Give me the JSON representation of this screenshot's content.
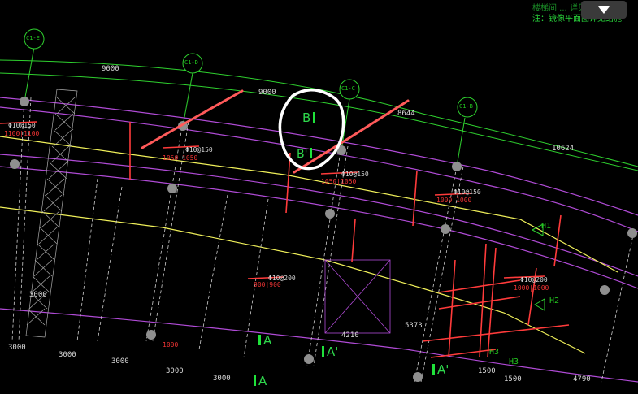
{
  "header": {
    "line1": "楼梯间 ... 详见 ...",
    "line2": "注：镜像平面图详见结施",
    "dropdown_icon": "chevron-down-icon"
  },
  "colors": {
    "background": "#000000",
    "axis_line": "#2fd12f",
    "beam_purple": "#b04bd6",
    "beam_yellow": "#f0f05a",
    "beam_red": "#ff3b3b",
    "annotation_stroke": "#ff5a5a",
    "highlight_circle": "#ffffff",
    "dim_text": "#d9d9d9"
  },
  "axes": {
    "bubbles": [
      "C1-E",
      "C1-D",
      "C1-C",
      "C1-B"
    ]
  },
  "dimensions": {
    "top": [
      "9000",
      "9000",
      "8644",
      "10624"
    ],
    "bottom": [
      "3000",
      "3000",
      "3000",
      "3000",
      "3000",
      "3000"
    ],
    "misc": [
      "4210",
      "5373",
      "1500",
      "1500",
      "4790",
      "3000"
    ]
  },
  "sections": [
    "B",
    "B'",
    "A",
    "A'",
    "A'",
    "A",
    "H1",
    "H2",
    "H3",
    "H3"
  ],
  "beam_labels": {
    "reinforce": [
      "Φ10@150",
      "Φ10@150",
      "Φ10@150",
      "Φ10@200",
      "Φ10@200",
      "Φ10@150"
    ],
    "sizes": [
      "1100|1100",
      "1050|1050",
      "1050|1050",
      "1000|1000",
      "900|900",
      "1000|1000",
      "1000"
    ]
  }
}
